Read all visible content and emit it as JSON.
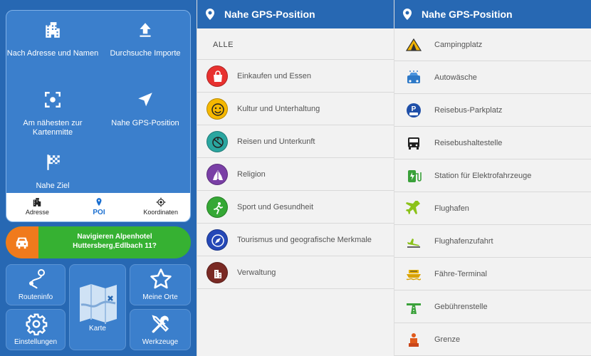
{
  "search_panel": {
    "options": [
      {
        "label": "Nach Adresse und Namen",
        "icon": "building-icon"
      },
      {
        "label": "Durchsuche Importe",
        "icon": "upload-icon"
      },
      {
        "label": "Am nähesten zur Kartenmitte",
        "icon": "target-center-icon"
      },
      {
        "label": "Nahe GPS-Position",
        "icon": "navigation-arrow-icon"
      },
      {
        "label": "Nahe Ziel",
        "icon": "checkered-flag-icon"
      }
    ],
    "tabs": [
      {
        "label": "Adresse",
        "icon": "building-icon"
      },
      {
        "label": "POI",
        "icon": "pin-icon"
      },
      {
        "label": "Koordinaten",
        "icon": "crosshair-icon"
      }
    ],
    "active_tab": "POI"
  },
  "nav_banner": {
    "text": "Navigieren Alpenhotel Huttersberg,Edlbach 11?",
    "icon": "car-icon"
  },
  "tiles": {
    "routeinfo": "Routeninfo",
    "karte": "Karte",
    "meine_orte": "Meine Orte",
    "einstellungen": "Einstellungen",
    "werkzeuge": "Werkzeuge"
  },
  "categories_panel": {
    "title": "Nahe GPS-Position",
    "all_label": "ALLE",
    "items": [
      {
        "label": "Einkaufen und Essen",
        "color": "#e8312f",
        "icon": "shopping-bag-icon"
      },
      {
        "label": "Kultur und Unterhaltung",
        "color": "#f6b800",
        "icon": "smiley-icon"
      },
      {
        "label": "Reisen und Unterkunft",
        "color": "#2aa6a0",
        "icon": "travel-icon"
      },
      {
        "label": "Religion",
        "color": "#7a3fa6",
        "icon": "praying-hands-icon"
      },
      {
        "label": "Sport und Gesundheit",
        "color": "#35a835",
        "icon": "running-icon"
      },
      {
        "label": "Tourismus und geografische Merkmale",
        "color": "#2548b7",
        "icon": "compass-icon"
      },
      {
        "label": "Verwaltung",
        "color": "#7a2a24",
        "icon": "government-building-icon"
      }
    ]
  },
  "subcategories_panel": {
    "title": "Nahe GPS-Position",
    "items": [
      {
        "label": "Campingplatz",
        "icon": "tent-icon"
      },
      {
        "label": "Autowäsche",
        "icon": "car-wash-icon"
      },
      {
        "label": "Reisebus-Parkplatz",
        "icon": "bus-parking-icon"
      },
      {
        "label": "Reisebushaltestelle",
        "icon": "bus-stop-icon"
      },
      {
        "label": "Station für Elektrofahrzeuge",
        "icon": "ev-charging-icon"
      },
      {
        "label": "Flughafen",
        "icon": "airplane-icon"
      },
      {
        "label": "Flughafenzufahrt",
        "icon": "airport-access-icon"
      },
      {
        "label": "Fähre-Terminal",
        "icon": "ferry-icon"
      },
      {
        "label": "Gebührenstelle",
        "icon": "toll-booth-icon"
      },
      {
        "label": "Grenze",
        "icon": "border-icon"
      }
    ]
  }
}
